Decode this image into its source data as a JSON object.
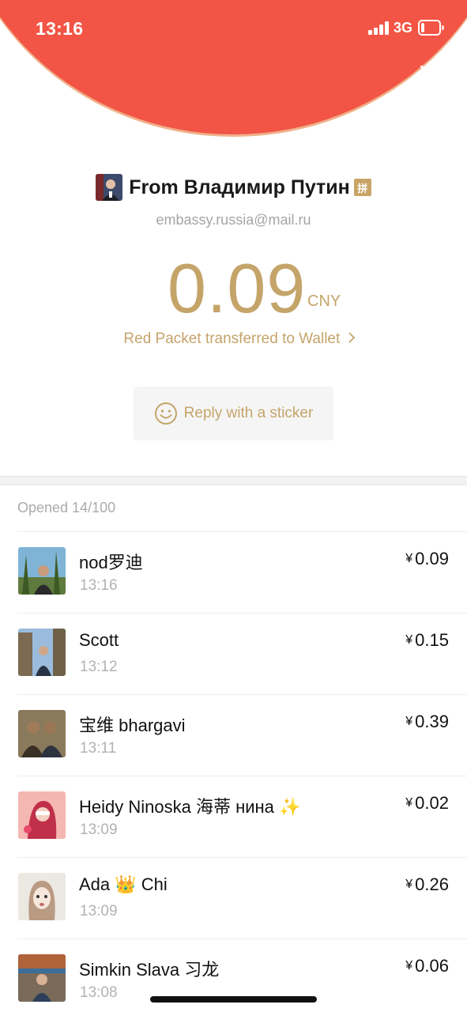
{
  "status_bar": {
    "time": "13:16",
    "network": "3G",
    "battery_level": 0.2
  },
  "header": {
    "back_icon": "chevron-left-icon",
    "menu_icon": "list-menu-icon",
    "accent_color": "#f25445"
  },
  "sender": {
    "name": "From Владимир Путин",
    "badge": "拼",
    "email": "embassy.russia@mail.ru"
  },
  "packet": {
    "amount": "0.09",
    "currency": "CNY",
    "wallet_link": "Red Packet transferred to Wallet",
    "reply_label": "Reply with a sticker",
    "accent_color": "#c5a46a"
  },
  "opened_text": "Opened 14/100",
  "recipients": [
    {
      "name": "nod罗迪",
      "time": "13:16",
      "currency_symbol": "¥",
      "amount": "0.09"
    },
    {
      "name": "Scott",
      "time": "13:12",
      "currency_symbol": "¥",
      "amount": "0.15"
    },
    {
      "name": "宝维 bhargavi",
      "time": "13:11",
      "currency_symbol": "¥",
      "amount": "0.39"
    },
    {
      "name": "Heidy Ninoska 海蒂 нина ✨",
      "time": "13:09",
      "currency_symbol": "¥",
      "amount": "0.02"
    },
    {
      "name": "Ada 👑 Chi",
      "time": "13:09",
      "currency_symbol": "¥",
      "amount": "0.26"
    },
    {
      "name": "Simkin Slava 习龙",
      "time": "13:08",
      "currency_symbol": "¥",
      "amount": "0.06"
    }
  ]
}
